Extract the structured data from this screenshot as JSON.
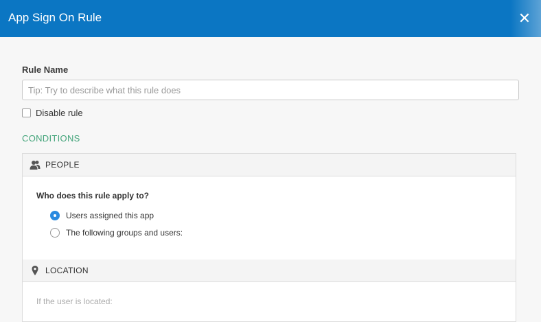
{
  "dialog": {
    "title": "App Sign On Rule",
    "close_glyph": "✕"
  },
  "form": {
    "rule_name_label": "Rule Name",
    "rule_name_placeholder": "Tip: Try to describe what this rule does",
    "rule_name_value": "",
    "disable_rule_label": "Disable rule",
    "disable_rule_checked": false,
    "conditions_heading": "CONDITIONS"
  },
  "people": {
    "header": "PEOPLE",
    "icon": "people-icon",
    "question": "Who does this rule apply to?",
    "options": [
      {
        "label": "Users assigned this app",
        "selected": true
      },
      {
        "label": "The following groups and users:",
        "selected": false
      }
    ]
  },
  "location": {
    "header": "LOCATION",
    "icon": "location-pin-icon",
    "subtext": "If the user is located:"
  },
  "colors": {
    "header_bg": "#0b76c3",
    "conditions_green": "#43a47a",
    "radio_blue": "#2a8ae0"
  }
}
